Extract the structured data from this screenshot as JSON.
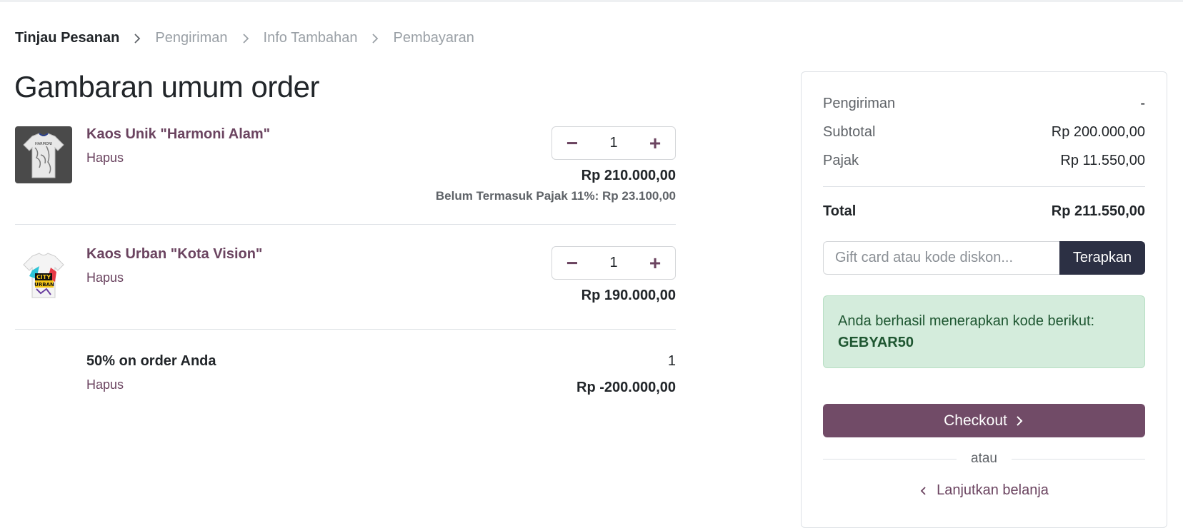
{
  "breadcrumb": {
    "steps": [
      "Tinjau Pesanan",
      "Pengiriman",
      "Info Tambahan",
      "Pembayaran"
    ]
  },
  "page_title": "Gambaran umum order",
  "items": [
    {
      "name": "Kaos Unik \"Harmoni Alam\"",
      "remove_label": "Hapus",
      "quantity": "1",
      "price": "Rp 210.000,00",
      "tax_note": "Belum Termasuk Pajak 11%: Rp 23.100,00"
    },
    {
      "name": "Kaos Urban \"Kota Vision\"",
      "remove_label": "Hapus",
      "quantity": "1",
      "price": "Rp 190.000,00"
    },
    {
      "name": "50% on order Anda",
      "remove_label": "Hapus",
      "quantity": "1",
      "price": "Rp -200.000,00"
    }
  ],
  "summary": {
    "shipping_label": "Pengiriman",
    "shipping_value": "-",
    "subtotal_label": "Subtotal",
    "subtotal_value": "Rp 200.000,00",
    "tax_label": "Pajak",
    "tax_value": "Rp 11.550,00",
    "total_label": "Total",
    "total_value": "Rp 211.550,00",
    "promo_placeholder": "Gift card atau kode diskon...",
    "promo_button": "Terapkan",
    "alert_text": "Anda berhasil menerapkan kode berikut:",
    "alert_code": "GEBYAR50",
    "checkout_label": "Checkout",
    "or_label": "atau",
    "continue_label": "Lanjutkan belanja"
  },
  "colors": {
    "brand": "#714b67",
    "link": "#6b4460",
    "dark_button": "#2c3044",
    "success_bg": "#d4ecdc"
  }
}
